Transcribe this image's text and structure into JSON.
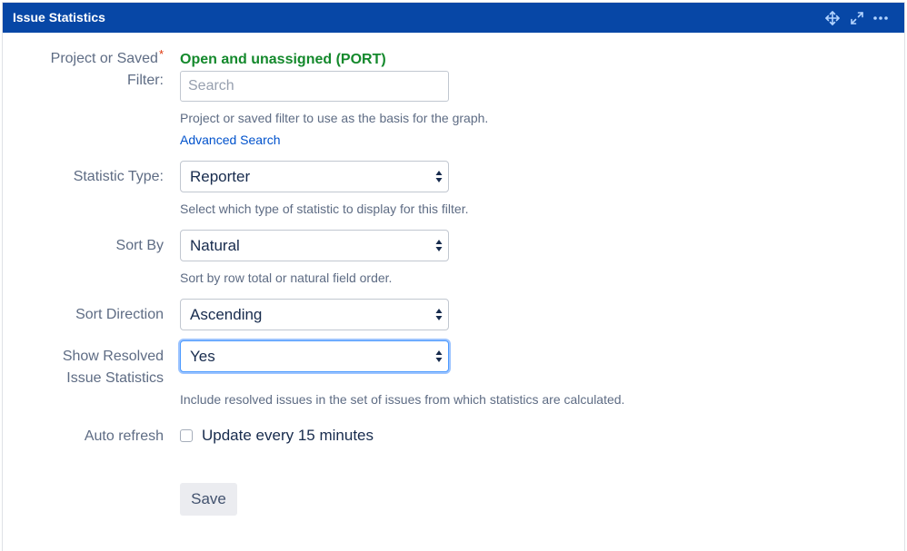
{
  "gadget": {
    "title": "Issue Statistics",
    "icons": [
      "move-icon",
      "expand-icon",
      "more-icon"
    ]
  },
  "form": {
    "filter": {
      "label_line1": "Project or Saved",
      "label_line2": "Filter:",
      "required_marker": "*",
      "current_value": "Open and unassigned (PORT)",
      "placeholder": "Search",
      "help": "Project or saved filter to use as the basis for the graph.",
      "advanced_link": "Advanced Search"
    },
    "statistic_type": {
      "label": "Statistic Type:",
      "value": "Reporter",
      "help": "Select which type of statistic to display for this filter."
    },
    "sort_by": {
      "label": "Sort By",
      "value": "Natural",
      "help": "Sort by row total or natural field order."
    },
    "sort_direction": {
      "label": "Sort Direction",
      "value": "Ascending"
    },
    "show_resolved": {
      "label_line1": "Show Resolved",
      "label_line2": "Issue Statistics",
      "value": "Yes",
      "help": "Include resolved issues in the set of issues from which statistics are calculated."
    },
    "auto_refresh": {
      "label": "Auto refresh",
      "checkbox_label": "Update every 15 minutes",
      "checked": false
    },
    "save_label": "Save"
  },
  "colors": {
    "header_bg": "#0747a6",
    "filter_value": "#14892c",
    "link": "#0052cc",
    "required": "#de350b",
    "focus_ring": "#4c9aff"
  }
}
